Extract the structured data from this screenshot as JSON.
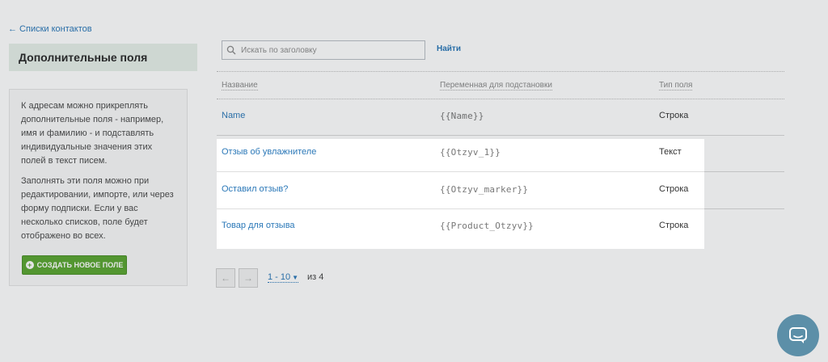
{
  "nav": {
    "back_link": "← Списки контактов"
  },
  "sidebar": {
    "title": "Дополнительные поля",
    "paragraphs": [
      "К адресам можно прикреплять дополнительные поля - например, имя и фамилию - и подставлять индивидуальные значения этих полей в текст писем.",
      "Заполнять эти поля можно при редактировании, импорте, или через форму подписки. Если у вас несколько списков, поле будет отображено во всех."
    ],
    "create_button": "Создать новое поле"
  },
  "search": {
    "placeholder": "Искать по заголовку",
    "value": "",
    "button": "Найти"
  },
  "table": {
    "headers": [
      "Название",
      "Переменная для подстановки",
      "Тип поля"
    ],
    "rows": [
      {
        "name": "Name",
        "variable": "{{Name}}",
        "type": "Строка"
      },
      {
        "name": "Отзыв об увлажнителе",
        "variable": "{{Otzyv_1}}",
        "type": "Текст"
      },
      {
        "name": "Оставил отзыв?",
        "variable": "{{Otzyv_marker}}",
        "type": "Строка"
      },
      {
        "name": "Товар для отзыва",
        "variable": "{{Product_Otzyv}}",
        "type": "Строка"
      }
    ]
  },
  "pagination": {
    "range": "1 - 10",
    "of": "из 4"
  },
  "colors": {
    "link": "#2b78b8",
    "button_green": "#5aa532",
    "chat": "#5c8fa8"
  },
  "icons": {
    "search": "search-icon",
    "prev": "arrow-left-icon",
    "next": "arrow-right-icon",
    "plus": "plus-circle-icon",
    "chat": "chat-icon"
  }
}
